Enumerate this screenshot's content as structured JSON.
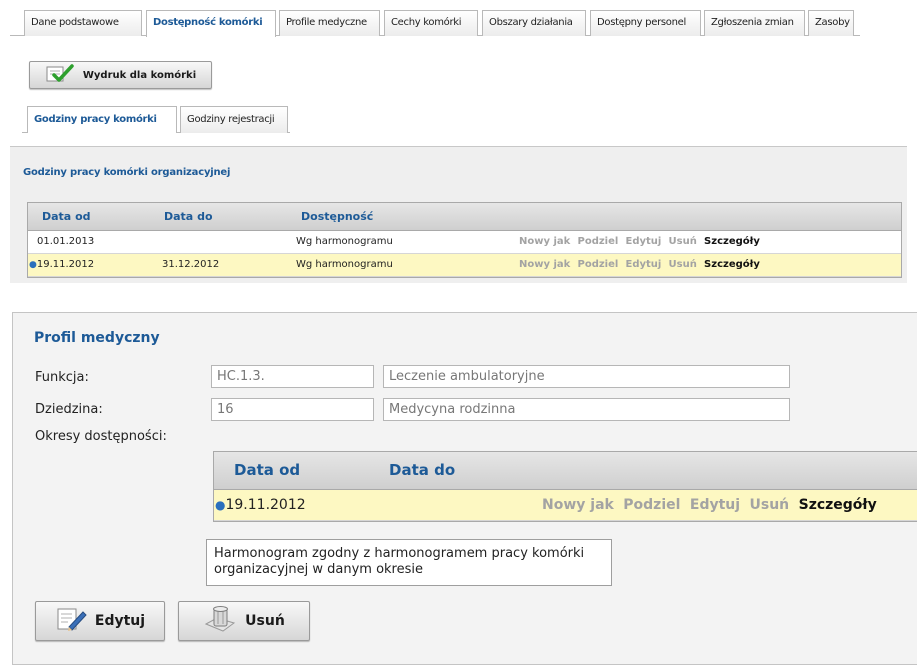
{
  "top_tabs": [
    {
      "label": "Dane podstawowe",
      "active": false
    },
    {
      "label": "Dostępność komórki",
      "active": true
    },
    {
      "label": "Profile medyczne",
      "active": false
    },
    {
      "label": "Cechy komórki",
      "active": false
    },
    {
      "label": "Obszary działania",
      "active": false
    },
    {
      "label": "Dostępny personel",
      "active": false
    },
    {
      "label": "Zgłoszenia zmian",
      "active": false
    },
    {
      "label": "Zasoby",
      "active": false
    }
  ],
  "print_button": {
    "label": "Wydruk dla komórki",
    "icon": "check-document-icon"
  },
  "sub_tabs": [
    {
      "label": "Godziny pracy komórki",
      "active": true
    },
    {
      "label": "Godziny rejestracji",
      "active": false
    }
  ],
  "hours_panel": {
    "title": "Godziny pracy komórki organizacyjnej",
    "columns": [
      "Data od",
      "Data do",
      "Dostępność"
    ],
    "rows": [
      {
        "date_from": "01.01.2013",
        "date_to": "",
        "availability": "Wg harmonogramu",
        "selected": false
      },
      {
        "date_from": "19.11.2012",
        "date_to": "31.12.2012",
        "availability": "Wg harmonogramu",
        "selected": true
      }
    ],
    "actions": [
      "Nowy jak",
      "Podziel",
      "Edytuj",
      "Usuń",
      "Szczegóły"
    ]
  },
  "profile": {
    "title": "Profil medyczny",
    "function_label": "Funkcja:",
    "function_code": "HC.1.3.",
    "function_name": "Leczenie ambulatoryjne",
    "domain_label": "Dziedzina:",
    "domain_code": "16",
    "domain_name": "Medycyna rodzinna",
    "periods_label": "Okresy dostępności:",
    "columns": [
      "Data od",
      "Data do"
    ],
    "rows": [
      {
        "date_from": "19.11.2012",
        "date_to": "",
        "selected": true
      }
    ],
    "actions": [
      "Nowy jak",
      "Podziel",
      "Edytuj",
      "Usuń",
      "Szczegóły"
    ],
    "note": "Harmonogram zgodny z harmonogramem pracy komórki organizacyjnej w danym okresie",
    "edit_label": "Edytuj",
    "delete_label": "Usuń"
  },
  "colors": {
    "accent": "#1d5a97",
    "selected_row": "#fdf8c2",
    "panel_bg": "#efefef"
  }
}
